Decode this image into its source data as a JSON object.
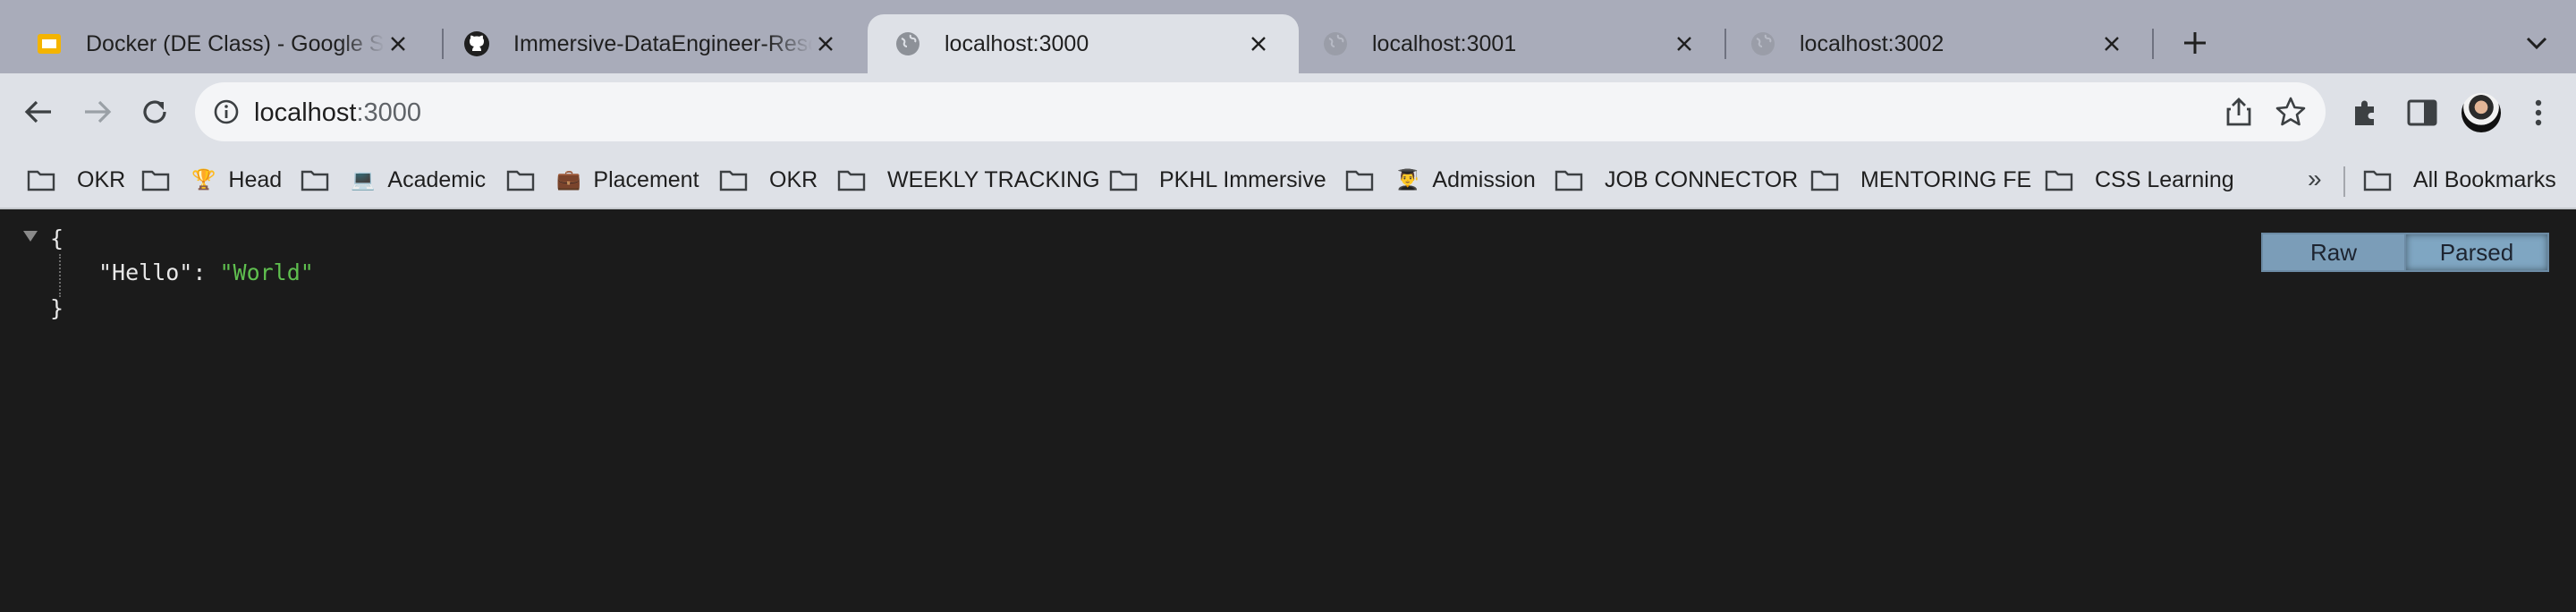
{
  "tabs": [
    {
      "title": "Docker (DE Class) - Google Slides",
      "favicon": "slides-icon",
      "active": false
    },
    {
      "title": "Immersive-DataEngineer-Resources",
      "favicon": "github-icon",
      "active": false
    },
    {
      "title": "localhost:3000",
      "favicon": "globe-icon",
      "active": true
    },
    {
      "title": "localhost:3001",
      "favicon": "globe-icon",
      "active": false
    },
    {
      "title": "localhost:3002",
      "favicon": "globe-icon",
      "active": false
    }
  ],
  "address_bar": {
    "host": "localhost",
    "port": ":3000"
  },
  "bookmarks": [
    {
      "label": "OKR",
      "emoji": ""
    },
    {
      "label": "Head",
      "emoji": "🏆"
    },
    {
      "label": "Academic",
      "emoji": "💻"
    },
    {
      "label": "Placement",
      "emoji": "💼"
    },
    {
      "label": "OKR",
      "emoji": ""
    },
    {
      "label": "WEEKLY TRACKING",
      "emoji": ""
    },
    {
      "label": "PKHL Immersive",
      "emoji": ""
    },
    {
      "label": "Admission",
      "emoji": "👨‍🎓"
    },
    {
      "label": "JOB CONNECTOR",
      "emoji": ""
    },
    {
      "label": "MENTORING FE",
      "emoji": ""
    },
    {
      "label": "CSS Learning",
      "emoji": ""
    }
  ],
  "bookmarks_overflow": "»",
  "all_bookmarks": "All Bookmarks",
  "json_view": {
    "open_brace": "{",
    "close_brace": "}",
    "key": "\"Hello\"",
    "colon": ": ",
    "value": "\"World\"",
    "raw_label": "Raw",
    "parsed_label": "Parsed"
  },
  "colors": {
    "tabstrip": "#a9acba",
    "toolbar": "#dee1e7",
    "page_bg": "#1b1b1b",
    "json_string": "#5fbf4f"
  }
}
